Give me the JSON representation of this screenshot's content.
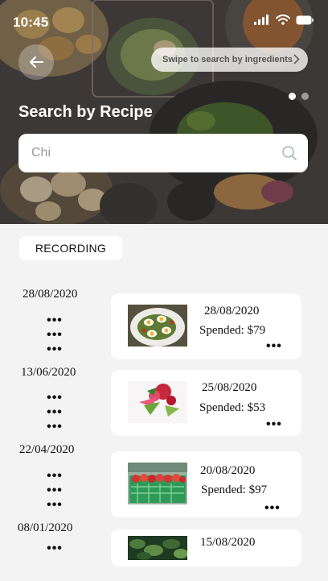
{
  "status_bar": {
    "time": "10:45"
  },
  "header": {
    "swipe_hint": "Swipe to search by ingredients",
    "title": "Search by Recipe",
    "search_value": "Chi"
  },
  "recording_label": "RECORDING",
  "timeline": [
    {
      "date": "28/08/2020"
    },
    {
      "date": "13/06/2020"
    },
    {
      "date": "22/04/2020"
    },
    {
      "date": "08/01/2020"
    }
  ],
  "cards": [
    {
      "date": "28/08/2020",
      "spent": "Spended: $79",
      "image": "egg-salad-bowl-photo"
    },
    {
      "date": "25/08/2020",
      "spent": "Spended: $53",
      "image": "flowers-bouquet-photo"
    },
    {
      "date": "20/08/2020",
      "spent": "Spended: $97",
      "image": "strawberry-crates-photo"
    },
    {
      "date": "15/08/2020",
      "image": "green-leaves-photo"
    }
  ],
  "more_glyph": "•••",
  "icons": [
    "back-arrow-icon",
    "chevron-right-icon",
    "search-icon",
    "signal-icon",
    "wifi-icon",
    "battery-icon"
  ]
}
